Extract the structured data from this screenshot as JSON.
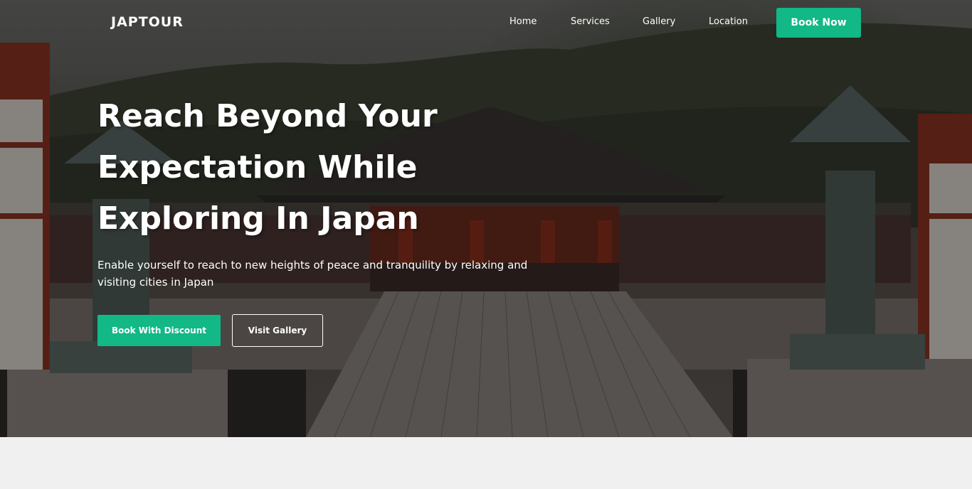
{
  "brand": {
    "name": "JAPTOUR"
  },
  "nav": {
    "links": [
      {
        "label": "Home"
      },
      {
        "label": "Services"
      },
      {
        "label": "Gallery"
      },
      {
        "label": "Location"
      }
    ],
    "cta_label": "Book Now"
  },
  "hero": {
    "title_lines": [
      "Reach Beyond Your",
      "Expectation While",
      "Exploring In Japan"
    ],
    "subtitle": "Enable yourself to reach to new heights of peace and tranquility by relaxing and visiting cities in Japan",
    "primary_button": "Book With Discount",
    "secondary_button": "Visit Gallery"
  },
  "colors": {
    "accent": "#12b886",
    "page_background": "#f0f0f0",
    "text_on_hero": "#ffffff"
  }
}
